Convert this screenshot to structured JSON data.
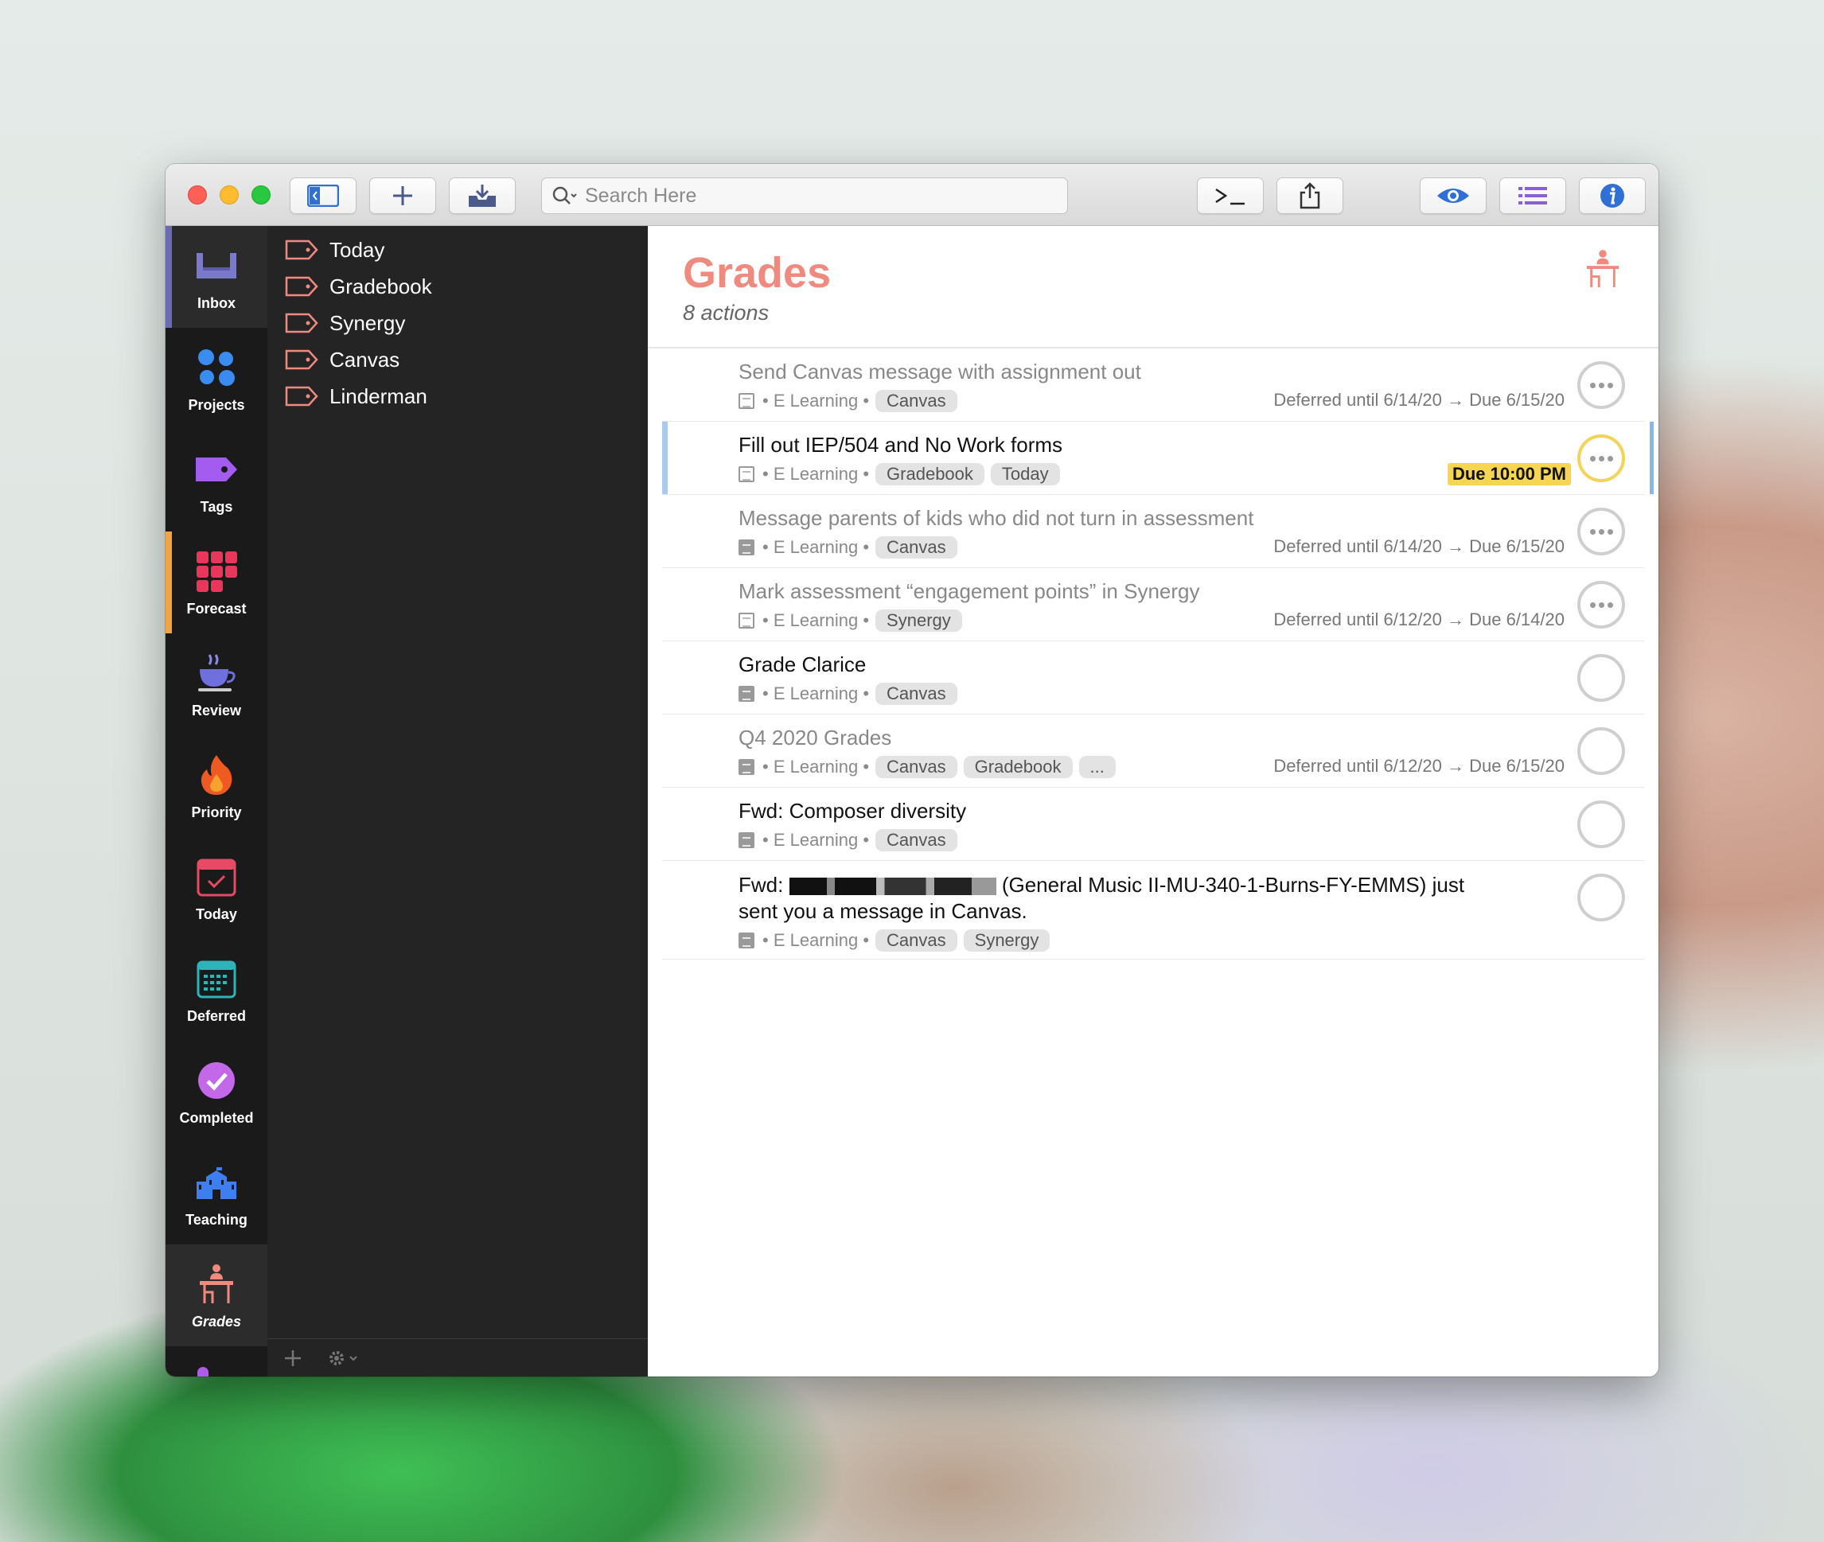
{
  "toolbar": {
    "search_placeholder": "Search Here"
  },
  "sidebar": {
    "items": [
      {
        "label": "Inbox",
        "icon": "inbox-icon"
      },
      {
        "label": "Projects",
        "icon": "projects-icon"
      },
      {
        "label": "Tags",
        "icon": "tag-icon"
      },
      {
        "label": "Forecast",
        "icon": "forecast-icon"
      },
      {
        "label": "Review",
        "icon": "review-cup-icon"
      },
      {
        "label": "Priority",
        "icon": "flame-icon"
      },
      {
        "label": "Today",
        "icon": "calendar-today-icon"
      },
      {
        "label": "Deferred",
        "icon": "calendar-grid-icon"
      },
      {
        "label": "Completed",
        "icon": "checkmark-circle-icon"
      },
      {
        "label": "Teaching",
        "icon": "school-building-icon"
      },
      {
        "label": "Grades",
        "icon": "desk-person-icon"
      }
    ]
  },
  "tags": [
    "Today",
    "Gradebook",
    "Synergy",
    "Canvas",
    "Linderman"
  ],
  "header": {
    "title": "Grades",
    "subtitle": "8 actions"
  },
  "actions": [
    {
      "title": "Send Canvas message with assignment out",
      "project": "• E Learning •",
      "tags": [
        "Canvas"
      ],
      "dates": "Deferred until 6/14/20 → Due 6/15/20"
    },
    {
      "title": "Fill out IEP/504 and No Work forms",
      "project": "• E Learning •",
      "tags": [
        "Gradebook",
        "Today"
      ],
      "due": "Due 10:00 PM"
    },
    {
      "title": "Message parents of kids who did not turn in assessment",
      "project": "• E Learning •",
      "tags": [
        "Canvas"
      ],
      "dates": "Deferred until 6/14/20 → Due 6/15/20"
    },
    {
      "title": "Mark assessment “engagement points” in Synergy",
      "project": "• E Learning •",
      "tags": [
        "Synergy"
      ],
      "dates": "Deferred until 6/12/20 → Due 6/14/20"
    },
    {
      "title": "Grade Clarice",
      "project": "• E Learning •",
      "tags": [
        "Canvas"
      ]
    },
    {
      "title": "Q4 2020 Grades",
      "project": "• E Learning •",
      "tags": [
        "Canvas",
        "Gradebook",
        "..."
      ],
      "dates": "Deferred until 6/12/20 → Due 6/15/20"
    },
    {
      "title": "Fwd: Composer diversity",
      "project": "• E Learning •",
      "tags": [
        "Canvas"
      ]
    },
    {
      "title_prefix": "Fwd:",
      "title_rest": "(General Music II-MU-340-1-Burns-FY-EMMS) just",
      "title_line2": "sent you a message in Canvas.",
      "project": "• E Learning •",
      "tags": [
        "Canvas",
        "Synergy"
      ]
    }
  ]
}
